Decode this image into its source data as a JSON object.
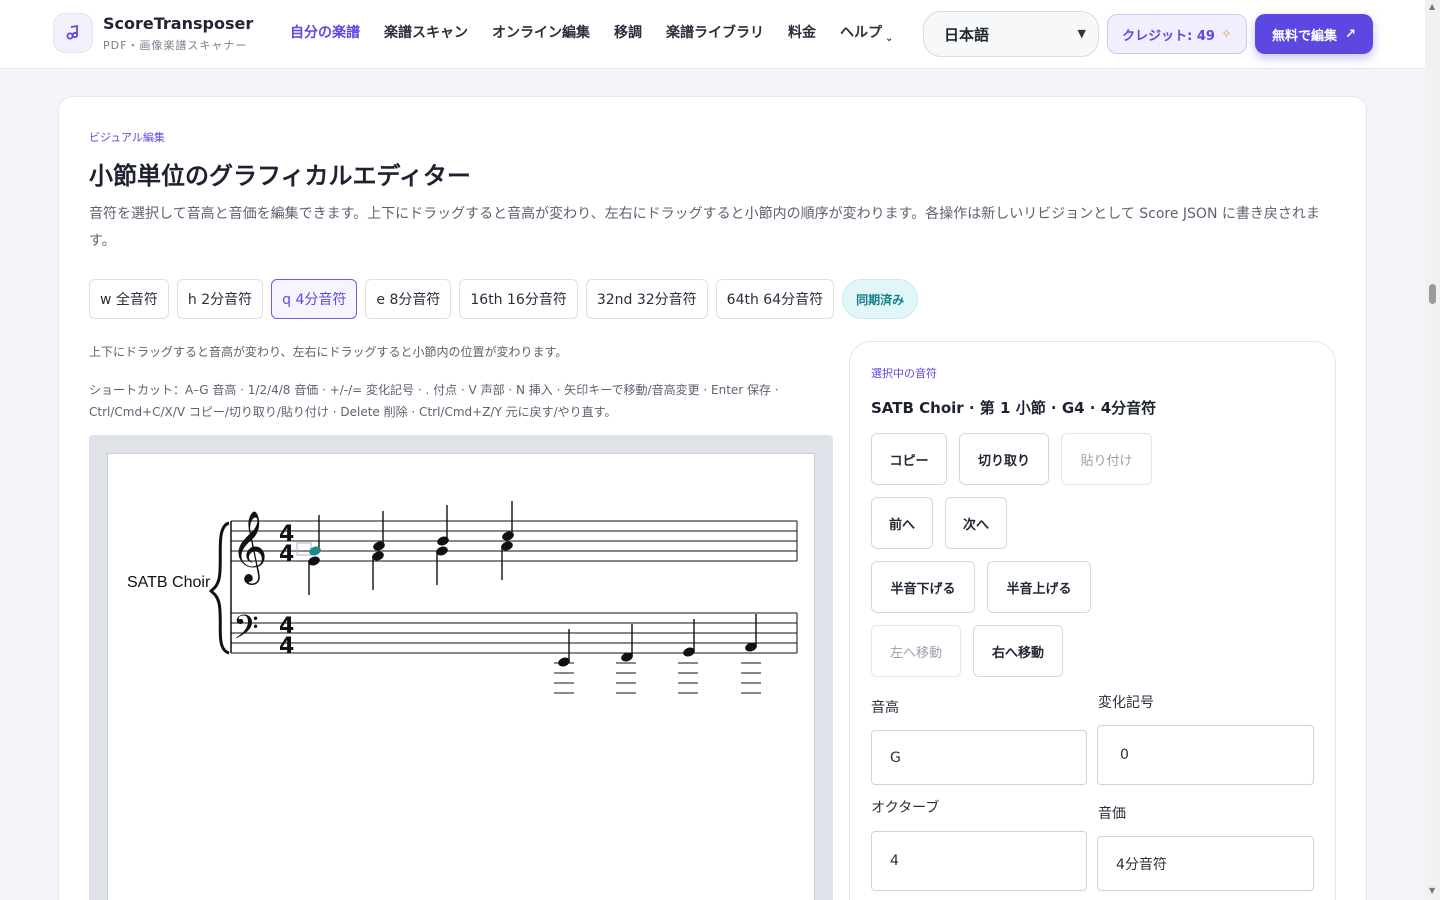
{
  "header": {
    "brand_name": "ScoreTransposer",
    "brand_sub": "PDF・画像楽譜スキャナー",
    "nav": [
      {
        "label": "自分の楽譜",
        "active": true
      },
      {
        "label": "楽譜スキャン"
      },
      {
        "label": "オンライン編集"
      },
      {
        "label": "移調"
      },
      {
        "label": "楽譜ライブラリ"
      },
      {
        "label": "料金"
      },
      {
        "label": "ヘルプ"
      }
    ],
    "language": "日本語",
    "credits_label": "クレジット: 49",
    "cta_label": "無料で編集"
  },
  "editor": {
    "eyebrow": "ビジュアル編集",
    "title": "小節単位のグラフィカルエディター",
    "description": "音符を選択して音高と音価を編集できます。上下にドラッグすると音高が変わり、左右にドラッグすると小節内の順序が変わります。各操作は新しいリビジョンとして Score JSON に書き戻されます。",
    "durations": [
      {
        "label": "w 全音符"
      },
      {
        "label": "h 2分音符"
      },
      {
        "label": "q 4分音符",
        "active": true
      },
      {
        "label": "e 8分音符"
      },
      {
        "label": "16th 16分音符"
      },
      {
        "label": "32nd 32分音符"
      },
      {
        "label": "64th 64分音符"
      }
    ],
    "sync_status": "同期済み",
    "hint_drag": "上下にドラッグすると音高が変わり、左右にドラッグすると小節内の位置が変わります。",
    "hint_shortcuts": "ショートカット：A–G 音高 · 1/2/4/8 音価 · +/-/= 変化記号 · . 付点 · V 声部 · N 挿入 · 矢印キーで移動/音高変更 · Enter 保存 · Ctrl/Cmd+C/X/V コピー/切り取り/貼り付け · Delete 削除 · Ctrl/Cmd+Z/Y 元に戻す/やり直す。"
  },
  "score": {
    "part_name": "SATB Choir",
    "time_signature": "4/4",
    "accent_color": "#1c8a86"
  },
  "panel": {
    "eyebrow": "選択中の音符",
    "title": "SATB Choir · 第 1 小節 · G4 · 4分音符",
    "buttons": {
      "copy": "コピー",
      "cut": "切り取り",
      "paste": "貼り付け",
      "prev": "前へ",
      "next": "次へ",
      "semitone_down": "半音下げる",
      "semitone_up": "半音上げる",
      "move_left": "左へ移動",
      "move_right": "右へ移動"
    },
    "fields": {
      "pitch_label": "音高",
      "pitch_value": "G",
      "accidental_label": "変化記号",
      "accidental_value": "0",
      "octave_label": "オクターブ",
      "octave_value": "4",
      "duration_label": "音価",
      "duration_value": "4分音符"
    }
  },
  "colors": {
    "accent": "#5b4be0",
    "sync": "#137f86"
  }
}
